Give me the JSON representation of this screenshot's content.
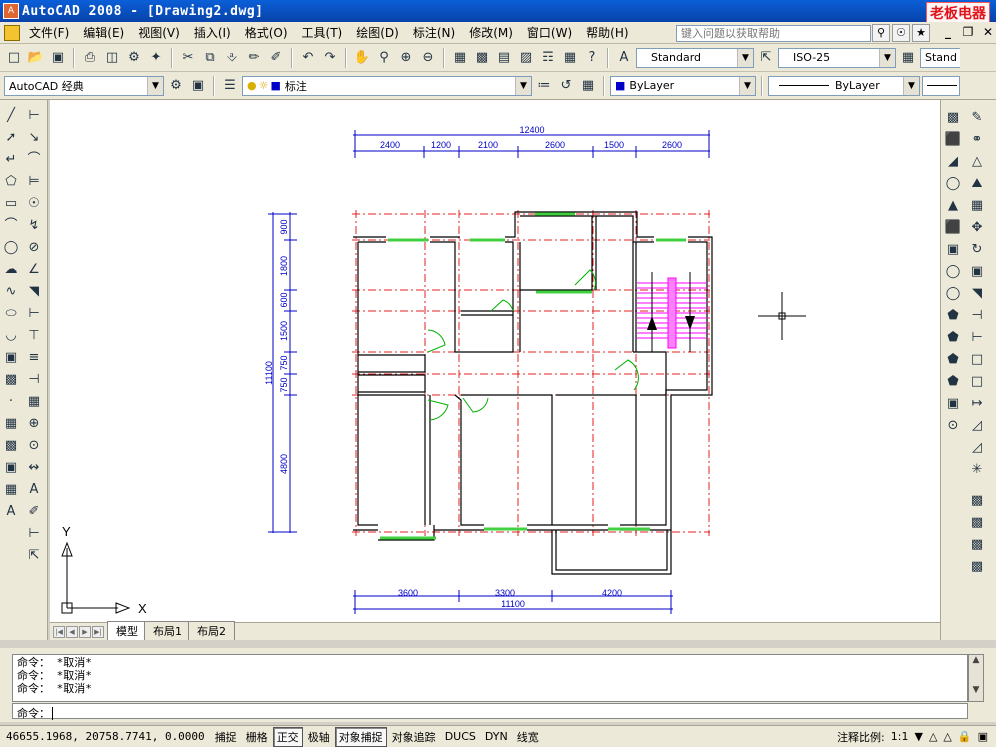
{
  "title": "AutoCAD 2008 - [Drawing2.dwg]",
  "brand": "老板电器",
  "menu": [
    "文件(F)",
    "编辑(E)",
    "视图(V)",
    "插入(I)",
    "格式(O)",
    "工具(T)",
    "绘图(D)",
    "标注(N)",
    "修改(M)",
    "窗口(W)",
    "帮助(H)"
  ],
  "help_placeholder": "键入问题以获取帮助",
  "toolbar": {
    "text_style": "Standard",
    "dim_style": "ISO-25",
    "table_style": "Stand",
    "workspace": "AutoCAD 经典",
    "layer": "标注",
    "color": "ByLayer",
    "linetype": "ByLayer"
  },
  "drawing": {
    "top_dims": [
      "2400",
      "1200",
      "2100",
      "2600",
      "1500",
      "2600"
    ],
    "top_total": "12400",
    "left_dims": [
      "900",
      "1800",
      "600",
      "1500",
      "750",
      "750",
      "4800"
    ],
    "left_total": "11100",
    "bottom_dims": [
      "3600",
      "3300",
      "4200"
    ],
    "bottom_total": "11100",
    "ucs_x": "X",
    "ucs_y": "Y",
    "colors": {
      "wall": "#000000",
      "axis": "#e02020",
      "dim": "#0000c8",
      "door": "#00b000",
      "window": "#40e040",
      "stair": "#ff00ff"
    }
  },
  "tabs": {
    "model": "模型",
    "layout1": "布局1",
    "layout2": "布局2"
  },
  "command": {
    "history": [
      "命令： *取消*",
      "命令： *取消*",
      "命令： *取消*"
    ],
    "prompt": "命令："
  },
  "status": {
    "coords": "46655.1968, 20758.7741, 0.0000",
    "toggles": [
      "捕捉",
      "栅格",
      "正交",
      "极轴",
      "对象捕捉",
      "对象追踪",
      "DUCS",
      "DYN",
      "线宽"
    ],
    "active_toggles": [
      "正交",
      "对象捕捉"
    ],
    "annotation_scale_label": "注释比例:",
    "annotation_scale": "1:1"
  }
}
